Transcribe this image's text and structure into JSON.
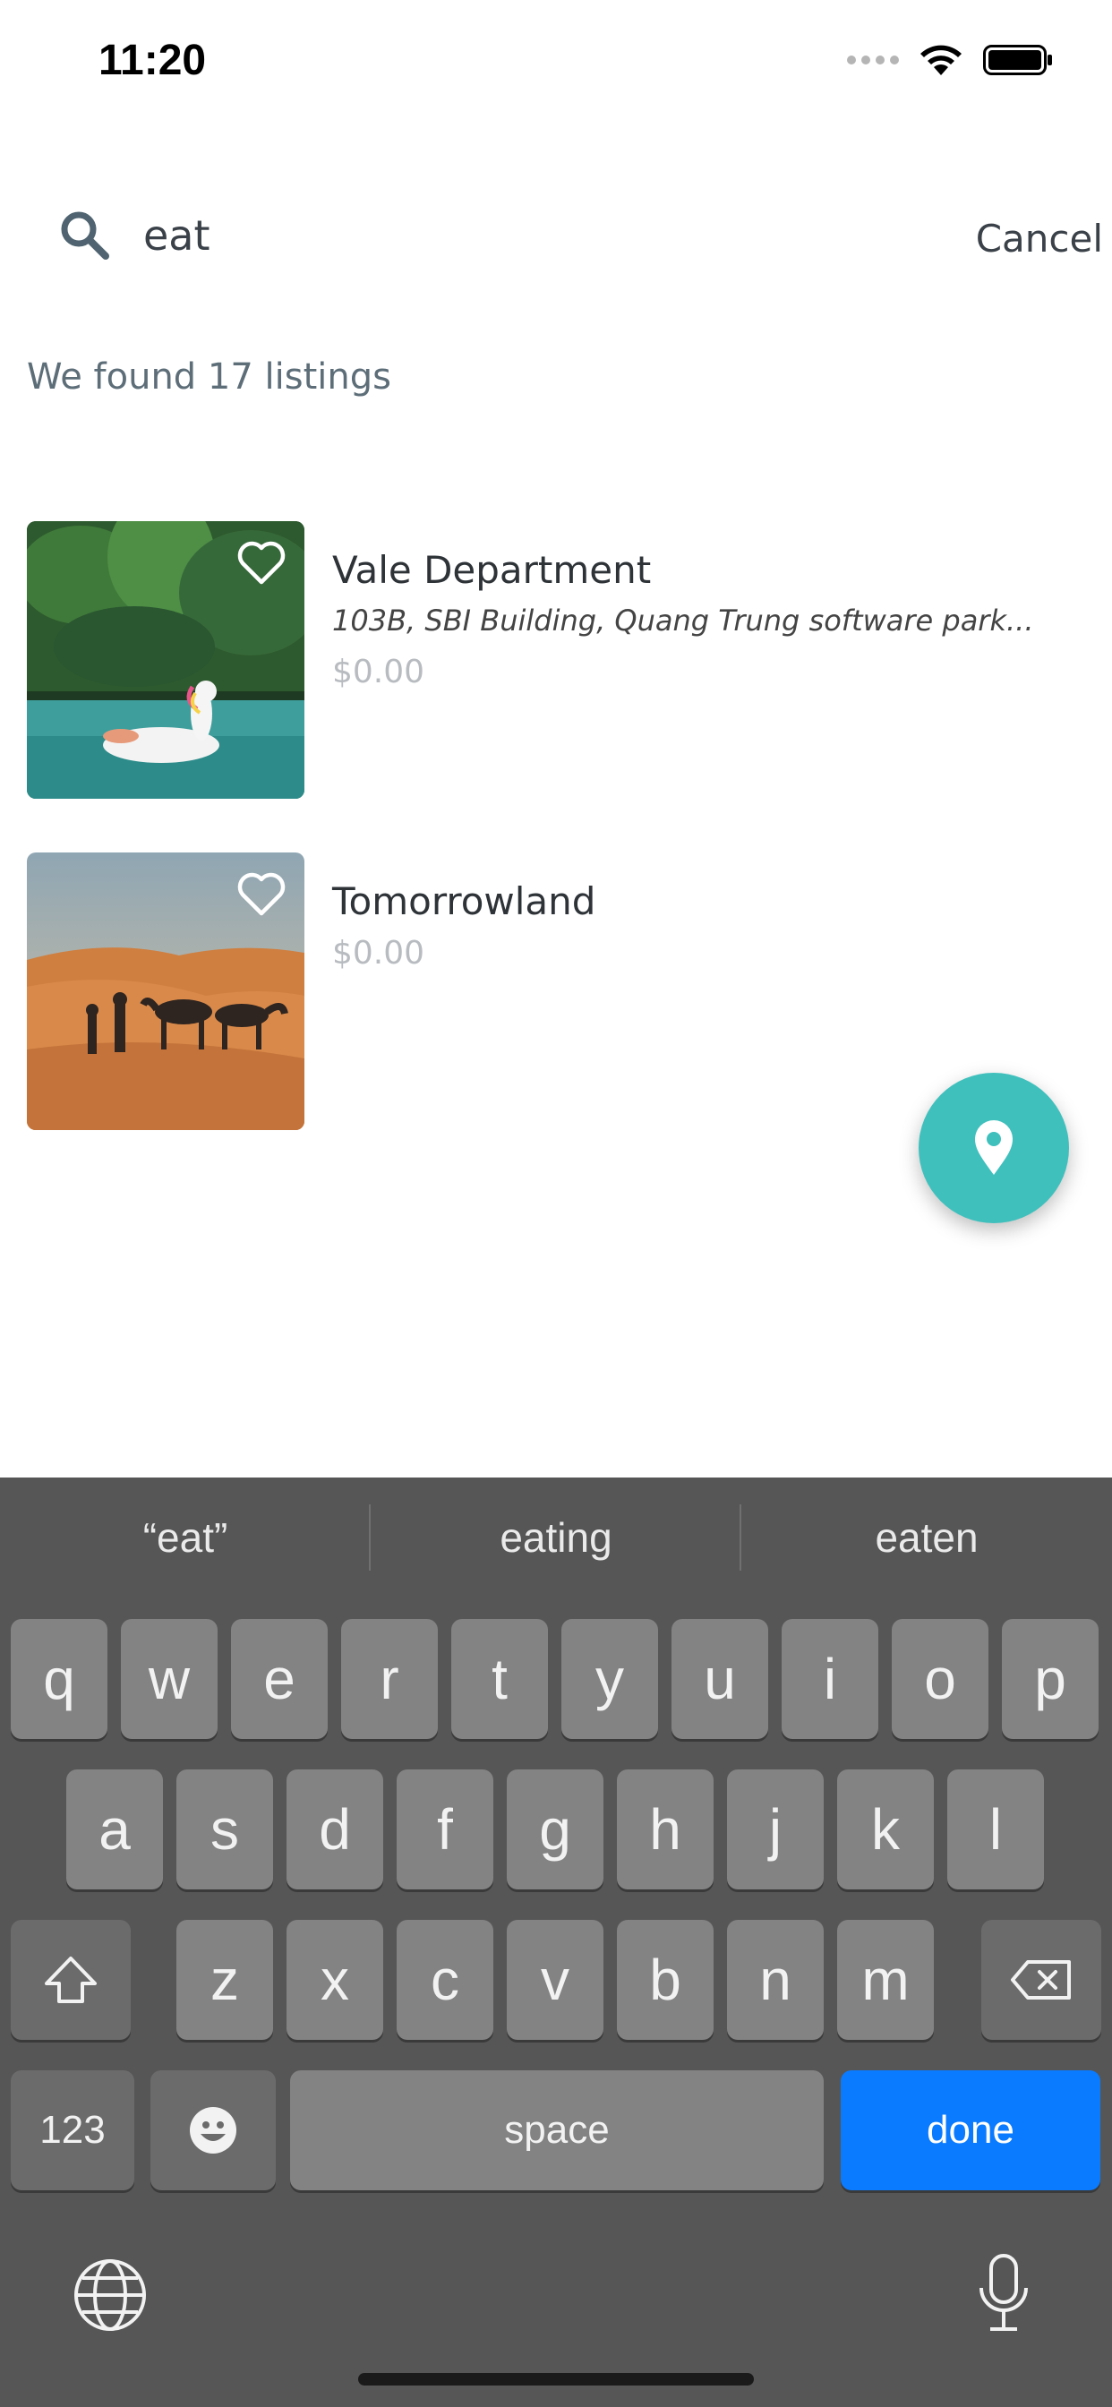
{
  "status_bar": {
    "time": "11:20"
  },
  "search": {
    "query": "eat",
    "cancel_label": "Cancel"
  },
  "results": {
    "count_text": "We found 17 listings"
  },
  "listings": [
    {
      "title": "Vale Department",
      "address": "103B, SBI Building, Quang Trung software park...",
      "price": "$0.00",
      "image": "pool-with-unicorn-float"
    },
    {
      "title": "Tomorrowland",
      "price": "$0.00",
      "image": "desert-with-camels"
    }
  ],
  "fab": {
    "icon": "map-pin-icon",
    "color": "#3fc0bd"
  },
  "keyboard": {
    "suggestions": [
      "“eat”",
      "eating",
      "eaten"
    ],
    "row1": [
      "q",
      "w",
      "e",
      "r",
      "t",
      "y",
      "u",
      "i",
      "o",
      "p"
    ],
    "row2": [
      "a",
      "s",
      "d",
      "f",
      "g",
      "h",
      "j",
      "k",
      "l"
    ],
    "row3": [
      "z",
      "x",
      "c",
      "v",
      "b",
      "n",
      "m"
    ],
    "numbers_label": "123",
    "space_label": "space",
    "done_label": "done",
    "done_color": "#0a7bff"
  }
}
